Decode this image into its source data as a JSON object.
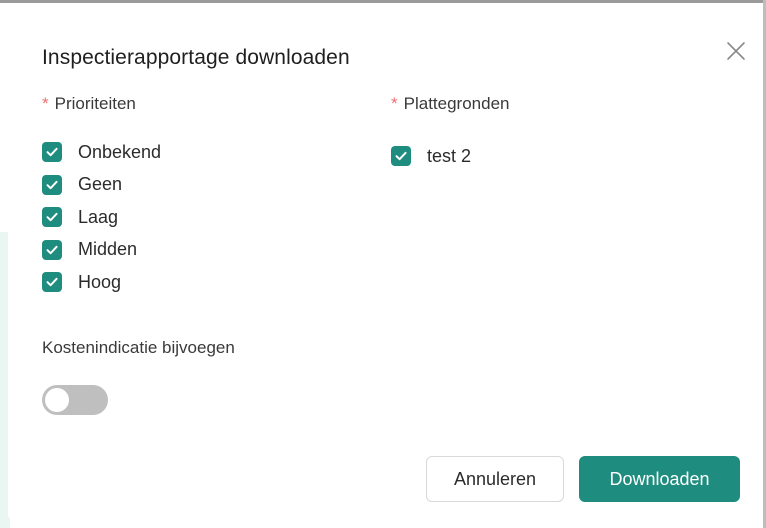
{
  "dialog": {
    "title": "Inspectierapportage downloaden",
    "close_icon": "close-icon"
  },
  "priorities": {
    "label": "Prioriteiten",
    "required_mark": "*",
    "items": [
      {
        "label": "Onbekend",
        "checked": true
      },
      {
        "label": "Geen",
        "checked": true
      },
      {
        "label": "Laag",
        "checked": true
      },
      {
        "label": "Midden",
        "checked": true
      },
      {
        "label": "Hoog",
        "checked": true
      }
    ]
  },
  "floorplans": {
    "label": "Plattegronden",
    "required_mark": "*",
    "items": [
      {
        "label": "test 2",
        "checked": true
      }
    ]
  },
  "cost_indication": {
    "label": "Kostenindicatie bijvoegen",
    "enabled": false
  },
  "actions": {
    "cancel_label": "Annuleren",
    "download_label": "Downloaden"
  },
  "colors": {
    "accent": "#1e8c7e",
    "required": "#f07070",
    "toggle_off": "#bfbfbf"
  }
}
